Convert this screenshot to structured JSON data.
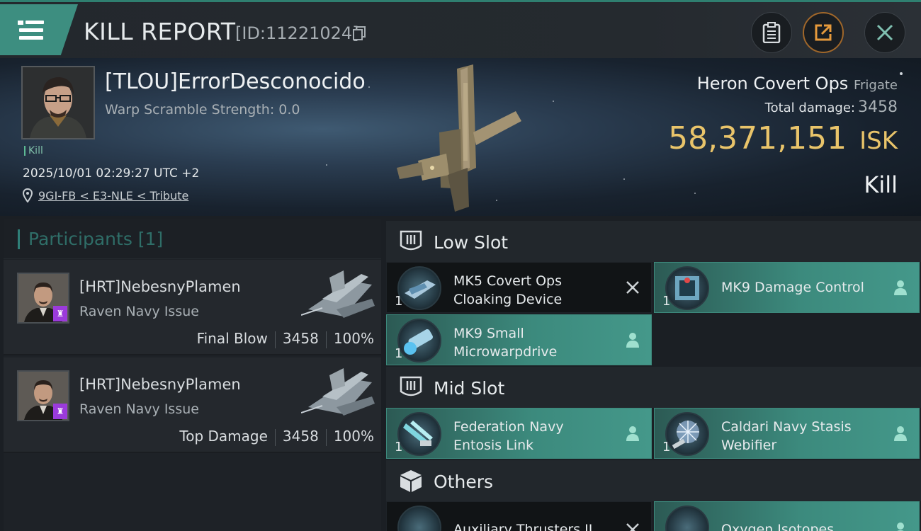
{
  "header": {
    "title": "KILL REPORT",
    "report_id": "[ID:11221024]"
  },
  "victim": {
    "name": "[TLOU]ErrorDesconocido",
    "warp_scramble": "Warp Scramble Strength: 0.0",
    "tag": "Kill",
    "datetime": "2025/10/01 02:29:27 UTC +2",
    "location": "9GI-FB < E3-NLE < Tribute",
    "ship_name": "Heron Covert Ops",
    "ship_class": "Frigate",
    "total_damage_label": "Total damage:",
    "total_damage": "3458",
    "isk_value": "58,371,151",
    "isk_unit": "ISK",
    "result": "Kill"
  },
  "participants": {
    "title": "Participants [1]",
    "list": [
      {
        "name": "[HRT]NebesnyPlamen",
        "ship": "Raven Navy Issue",
        "role": "Final Blow",
        "damage": "3458",
        "percent": "100%"
      },
      {
        "name": "[HRT]NebesnyPlamen",
        "ship": "Raven Navy Issue",
        "role": "Top Damage",
        "damage": "3458",
        "percent": "100%"
      }
    ]
  },
  "slots": {
    "low": {
      "title": "Low Slot",
      "items": [
        {
          "qty": "1",
          "name1": "MK5 Covert Ops",
          "name2": "Cloaking Device",
          "status": "destroyed"
        },
        {
          "qty": "1",
          "name1": "MK9 Damage Control",
          "name2": "",
          "status": "dropped"
        },
        {
          "qty": "1",
          "name1": "MK9 Small",
          "name2": "Microwarpdrive",
          "status": "dropped"
        }
      ]
    },
    "mid": {
      "title": "Mid Slot",
      "items": [
        {
          "qty": "1",
          "name1": "Federation Navy",
          "name2": "Entosis Link",
          "status": "dropped"
        },
        {
          "qty": "1",
          "name1": "Caldari Navy Stasis",
          "name2": "Webifier",
          "status": "dropped"
        }
      ]
    },
    "others": {
      "title": "Others",
      "items": [
        {
          "name1": "Auxiliary Thrusters II",
          "status": "destroyed"
        },
        {
          "name1": "Oxygen Isotopes",
          "status": "dropped"
        }
      ]
    }
  },
  "colors": {
    "accent_teal": "#3d8e80",
    "isk_gold": "#e9c46a",
    "dropped_item_bg": "#3c8a7d",
    "destroyed_item_bg": "#111416",
    "corp_badge": "#9b3bdb"
  }
}
